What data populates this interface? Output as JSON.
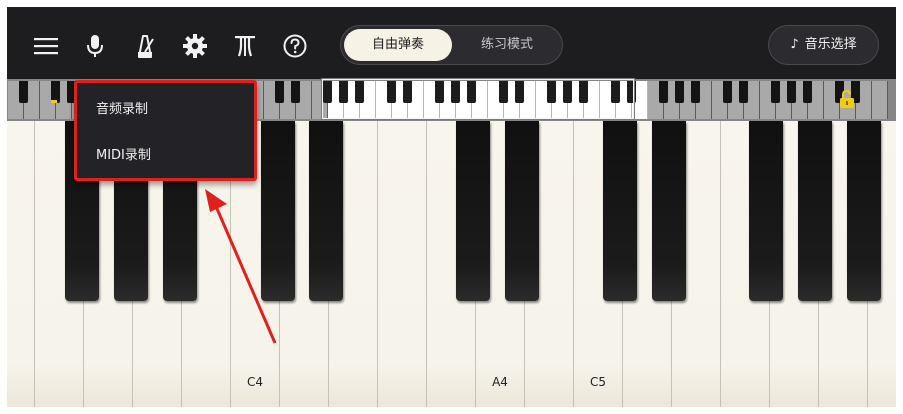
{
  "toolbar": {
    "icons": [
      "menu-icon",
      "microphone-icon",
      "metronome-icon",
      "gear-icon",
      "tuning-fork-icon",
      "help-icon"
    ],
    "modes": {
      "free_play": "自由弹奏",
      "practice": "练习模式",
      "active": "free_play"
    },
    "music_select": {
      "icon": "music-note-icon",
      "label": "音乐选择"
    }
  },
  "record_menu": {
    "items": [
      {
        "label": "音频录制"
      },
      {
        "label": "MIDI录制"
      }
    ]
  },
  "keyboard": {
    "labels": {
      "c4": "C4",
      "a4": "A4",
      "c5": "C5"
    },
    "lock_icon": "lock-open-icon"
  },
  "colors": {
    "accent": "#f2cc13",
    "highlight": "#e0201a",
    "toolbar_bg": "#1d1c1f"
  }
}
